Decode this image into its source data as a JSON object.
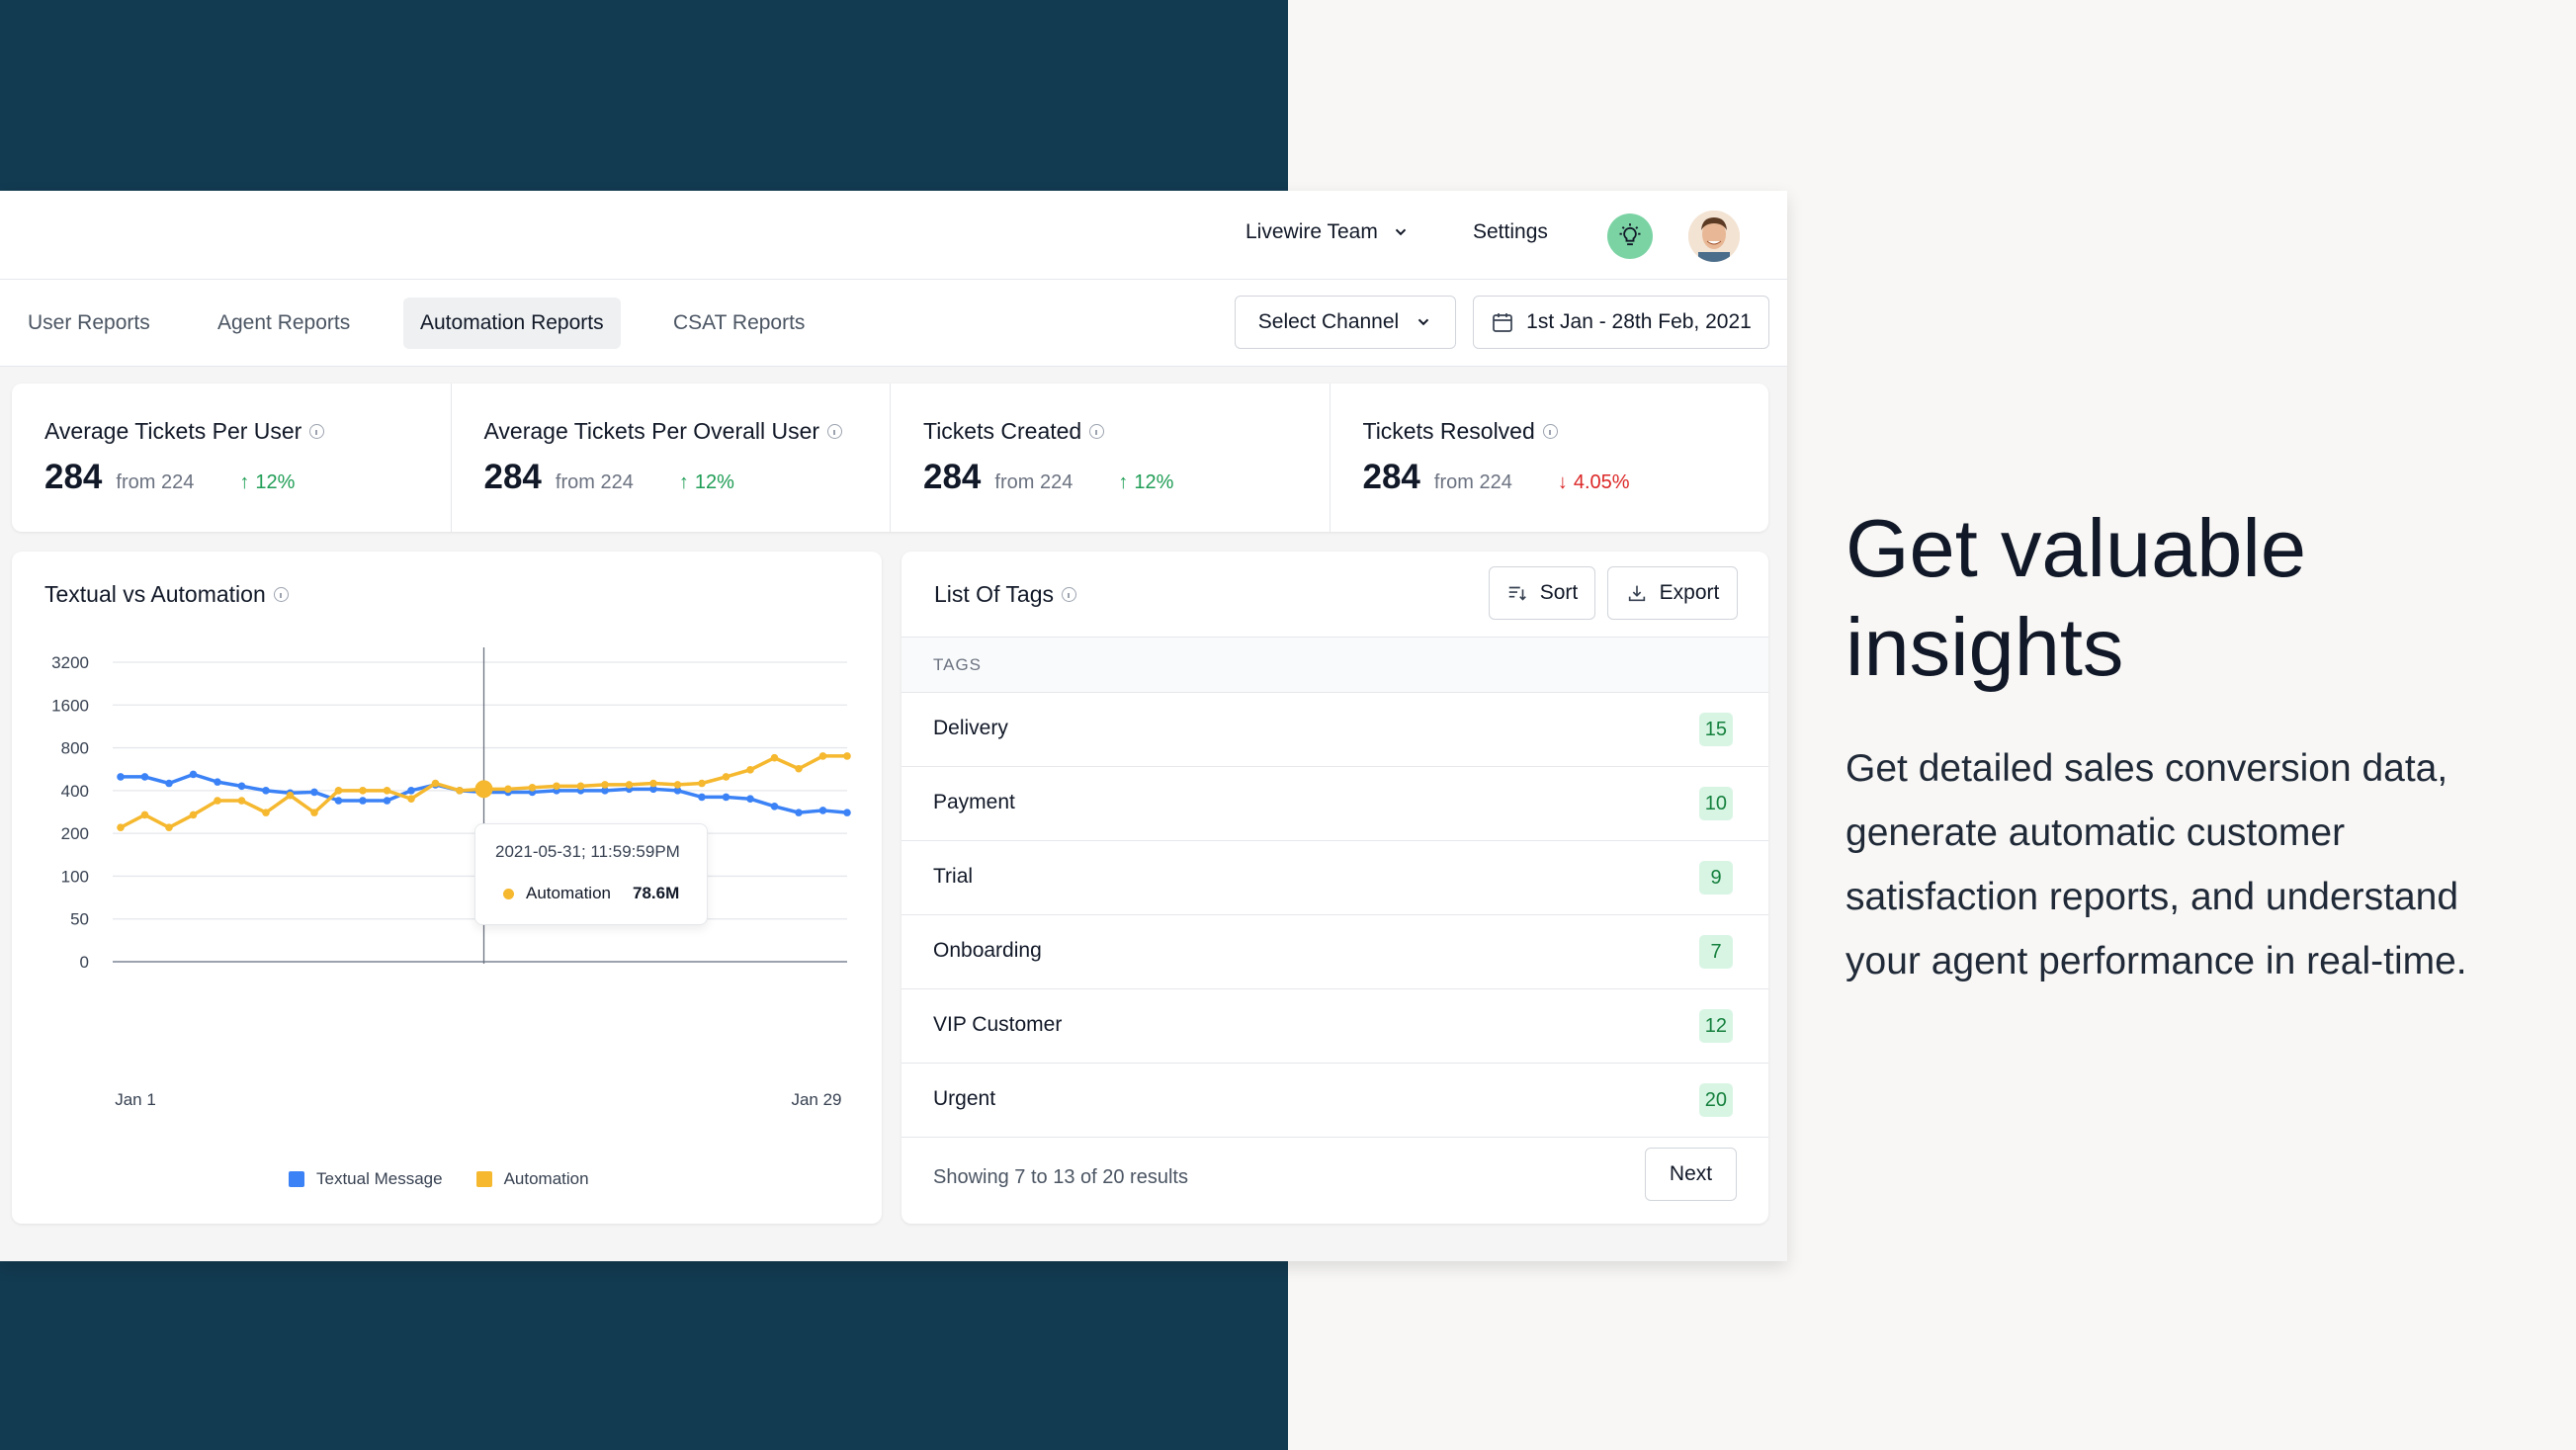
{
  "header": {
    "team": "Livewire Team",
    "settings": "Settings"
  },
  "tabs": [
    {
      "label": "User Reports",
      "active": false
    },
    {
      "label": "Agent Reports",
      "active": false
    },
    {
      "label": "Automation Reports",
      "active": true
    },
    {
      "label": "CSAT Reports",
      "active": false
    }
  ],
  "filters": {
    "channel": "Select Channel",
    "date_range": "1st Jan - 28th Feb, 2021"
  },
  "stats": [
    {
      "label": "Average Tickets Per User",
      "value": "284",
      "from": "from 224",
      "change": "12%",
      "direction": "up"
    },
    {
      "label": "Average Tickets Per Overall User",
      "value": "284",
      "from": "from 224",
      "change": "12%",
      "direction": "up"
    },
    {
      "label": "Tickets Created",
      "value": "284",
      "from": "from 224",
      "change": "12%",
      "direction": "up"
    },
    {
      "label": "Tickets Resolved",
      "value": "284",
      "from": "from 224",
      "change": "4.05%",
      "direction": "down"
    }
  ],
  "chart": {
    "title": "Textual vs Automation",
    "tooltip": {
      "date": "2021-05-31; 11:59:59PM",
      "series": "Automation",
      "value": "78.6M"
    },
    "legend": [
      {
        "name": "Textual Message",
        "color": "#3b82f6"
      },
      {
        "name": "Automation",
        "color": "#f5b82e"
      }
    ]
  },
  "chart_data": {
    "type": "line",
    "title": "Textual vs Automation",
    "y_scale": "log",
    "y_ticks": [
      "3200",
      "1600",
      "800",
      "400",
      "200",
      "100",
      "50",
      "0"
    ],
    "x_tick_labels": [
      "Jan 1",
      "Jan 29"
    ],
    "x": [
      1,
      2,
      3,
      4,
      5,
      6,
      7,
      8,
      9,
      10,
      11,
      12,
      13,
      14,
      15,
      16,
      17,
      18,
      19,
      20,
      21,
      22,
      23,
      24,
      25,
      26,
      27,
      28,
      29,
      30,
      31
    ],
    "series": [
      {
        "name": "Textual Message",
        "color": "#3b82f6",
        "values": [
          500,
          500,
          450,
          520,
          460,
          430,
          400,
          385,
          390,
          340,
          340,
          340,
          400,
          440,
          400,
          390,
          390,
          390,
          400,
          400,
          400,
          410,
          410,
          400,
          360,
          360,
          350,
          310,
          280,
          290,
          280
        ]
      },
      {
        "name": "Automation",
        "color": "#f5b82e",
        "values": [
          220,
          270,
          220,
          270,
          340,
          340,
          280,
          370,
          280,
          400,
          400,
          400,
          350,
          450,
          400,
          410,
          410,
          420,
          430,
          430,
          440,
          440,
          450,
          440,
          450,
          500,
          560,
          680,
          570,
          700,
          700
        ]
      }
    ],
    "highlight": {
      "series": "Automation",
      "index": 15
    },
    "grid": true,
    "legend_position": "bottom"
  },
  "tags": {
    "title": "List Of Tags",
    "sort": "Sort",
    "export": "Export",
    "column": "TAGS",
    "rows": [
      {
        "name": "Delivery",
        "count": "15"
      },
      {
        "name": "Payment",
        "count": "10"
      },
      {
        "name": "Trial",
        "count": "9"
      },
      {
        "name": "Onboarding",
        "count": "7"
      },
      {
        "name": "VIP Customer",
        "count": "12"
      },
      {
        "name": "Urgent",
        "count": "20"
      }
    ],
    "footer": "Showing 7 to 13 of 20 results",
    "next": "Next"
  },
  "hero": {
    "title": "Get valuable insights",
    "text": "Get detailed sales conversion data, generate automatic customer satisfaction reports, and understand your agent performance in real-time."
  },
  "colors": {
    "navy": "#123a50",
    "accent_green": "#7bd3a4",
    "up": "#1f9d55",
    "down": "#dc2626"
  }
}
